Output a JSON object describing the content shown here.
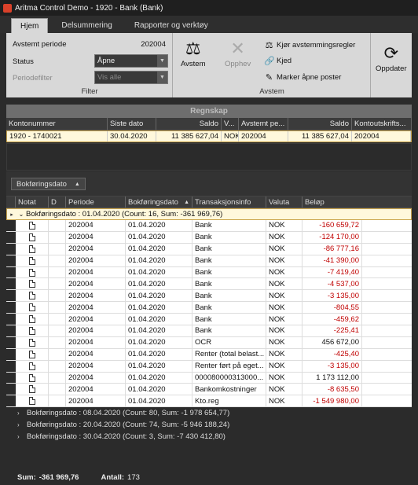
{
  "window": {
    "title": "Aritma Control Demo - 1920 - Bank (Bank)"
  },
  "tabs": [
    {
      "label": "Hjem",
      "active": true
    },
    {
      "label": "Delsummering",
      "active": false
    },
    {
      "label": "Rapporter og verktøy",
      "active": false
    }
  ],
  "filter": {
    "avstemt_periode_label": "Avstemt periode",
    "avstemt_periode_value": "202004",
    "status_label": "Status",
    "status_value": "Åpne",
    "periodefilter_label": "Periodefilter",
    "periodefilter_value": "Vis alle",
    "group_label": "Filter"
  },
  "avstem": {
    "avstem_label": "Avstem",
    "opphev_label": "Opphev",
    "kjor_label": "Kjør avstemmingsregler",
    "kjed_label": "Kjed",
    "marker_label": "Marker åpne poster",
    "group_label": "Avstem"
  },
  "oppdater": {
    "label": "Oppdater"
  },
  "regnskap": {
    "header": "Regnskap",
    "columns": [
      "Kontonummer",
      "Siste dato",
      "Saldo",
      "V...",
      "Avstemt pe...",
      "Saldo",
      "Kontoutskrifts..."
    ],
    "row": [
      "1920 - 1740021",
      "30.04.2020",
      "11 385 627,04",
      "NOK",
      "202004",
      "11 385 627,04",
      "202004"
    ]
  },
  "grouping": {
    "chip_label": "Bokføringsdato",
    "chip_arrow": "▲"
  },
  "grid": {
    "columns": [
      "Notat",
      "D",
      "Periode",
      "Bokføringsdato",
      "Transaksjonsinfo",
      "Valuta",
      "Beløp"
    ],
    "groups": [
      {
        "label": "Bokføringsdato : 01.04.2020 (Count: 16,  Sum: -361 969,76)",
        "expanded": true
      },
      {
        "label": "Bokføringsdato : 08.04.2020 (Count: 80,  Sum: -1 978 654,77)",
        "expanded": false
      },
      {
        "label": "Bokføringsdato : 20.04.2020 (Count: 74,  Sum: -5 946 188,24)",
        "expanded": false
      },
      {
        "label": "Bokføringsdato : 30.04.2020 (Count: 3,  Sum: -7 430 412,80)",
        "expanded": false
      }
    ],
    "rows": [
      {
        "periode": "202004",
        "dato": "01.04.2020",
        "info": "Bank",
        "valuta": "NOK",
        "belop": "-160 659,72",
        "neg": true
      },
      {
        "periode": "202004",
        "dato": "01.04.2020",
        "info": "Bank",
        "valuta": "NOK",
        "belop": "-124 170,00",
        "neg": true
      },
      {
        "periode": "202004",
        "dato": "01.04.2020",
        "info": "Bank",
        "valuta": "NOK",
        "belop": "-86 777,16",
        "neg": true
      },
      {
        "periode": "202004",
        "dato": "01.04.2020",
        "info": "Bank",
        "valuta": "NOK",
        "belop": "-41 390,00",
        "neg": true
      },
      {
        "periode": "202004",
        "dato": "01.04.2020",
        "info": "Bank",
        "valuta": "NOK",
        "belop": "-7 419,40",
        "neg": true
      },
      {
        "periode": "202004",
        "dato": "01.04.2020",
        "info": "Bank",
        "valuta": "NOK",
        "belop": "-4 537,00",
        "neg": true
      },
      {
        "periode": "202004",
        "dato": "01.04.2020",
        "info": "Bank",
        "valuta": "NOK",
        "belop": "-3 135,00",
        "neg": true
      },
      {
        "periode": "202004",
        "dato": "01.04.2020",
        "info": "Bank",
        "valuta": "NOK",
        "belop": "-804,55",
        "neg": true
      },
      {
        "periode": "202004",
        "dato": "01.04.2020",
        "info": "Bank",
        "valuta": "NOK",
        "belop": "-459,62",
        "neg": true
      },
      {
        "periode": "202004",
        "dato": "01.04.2020",
        "info": "Bank",
        "valuta": "NOK",
        "belop": "-225,41",
        "neg": true
      },
      {
        "periode": "202004",
        "dato": "01.04.2020",
        "info": "OCR",
        "valuta": "NOK",
        "belop": "456 672,00",
        "neg": false
      },
      {
        "periode": "202004",
        "dato": "01.04.2020",
        "info": "Renter (total belast...",
        "valuta": "NOK",
        "belop": "-425,40",
        "neg": true
      },
      {
        "periode": "202004",
        "dato": "01.04.2020",
        "info": "Renter ført på eget...",
        "valuta": "NOK",
        "belop": "-3 135,00",
        "neg": true
      },
      {
        "periode": "202004",
        "dato": "01.04.2020",
        "info": "000080000313000...",
        "valuta": "NOK",
        "belop": "1 173 112,00",
        "neg": false
      },
      {
        "periode": "202004",
        "dato": "01.04.2020",
        "info": "Bankomkostninger",
        "valuta": "NOK",
        "belop": "-8 635,50",
        "neg": true
      },
      {
        "periode": "202004",
        "dato": "01.04.2020",
        "info": "Kto.reg",
        "valuta": "NOK",
        "belop": "-1 549 980,00",
        "neg": true
      }
    ]
  },
  "status": {
    "sum_label": "Sum:",
    "sum_value": "-361 969,76",
    "antall_label": "Antall:",
    "antall_value": "173"
  }
}
